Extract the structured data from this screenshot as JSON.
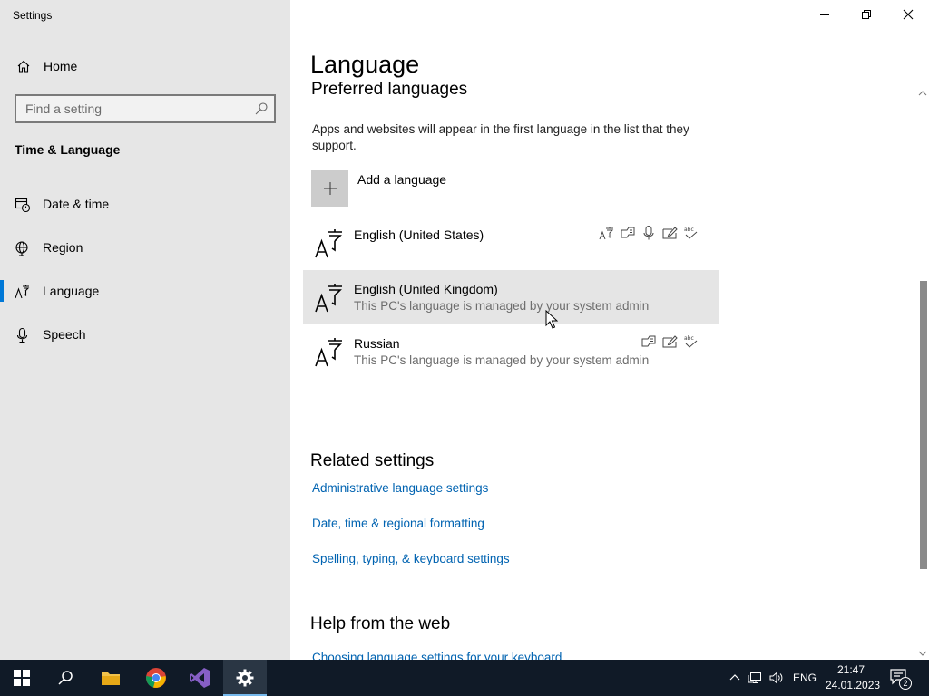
{
  "window": {
    "app_title": "Settings",
    "minimize_icon": "minimize-icon",
    "restore_icon": "restore-icon",
    "close_icon": "close-icon"
  },
  "sidebar": {
    "home_label": "Home",
    "search_placeholder": "Find a setting",
    "section_title": "Time & Language",
    "items": [
      {
        "label": "Date & time",
        "icon": "calendar-clock-icon"
      },
      {
        "label": "Region",
        "icon": "globe-icon"
      },
      {
        "label": "Language",
        "icon": "language-icon",
        "selected": true
      },
      {
        "label": "Speech",
        "icon": "microphone-icon"
      }
    ]
  },
  "main": {
    "page_title": "Language",
    "preferred_title": "Preferred languages",
    "description": "Apps and websites will appear in the first language in the list that they support.",
    "add_language_label": "Add a language",
    "languages": [
      {
        "name": "English (United States)",
        "sub": "",
        "features": [
          "display-language-icon",
          "text-to-speech-icon",
          "speech-recognition-icon",
          "handwriting-icon",
          "spelling-icon"
        ]
      },
      {
        "name": "English (United Kingdom)",
        "sub": "This PC's language is managed by your system admin",
        "features": []
      },
      {
        "name": "Russian",
        "sub": "This PC's language is managed by your system admin",
        "features": [
          "text-to-speech-icon",
          "handwriting-icon",
          "spelling-icon"
        ]
      }
    ],
    "related_title": "Related settings",
    "related_links": [
      "Administrative language settings",
      "Date, time & regional formatting",
      "Spelling, typing, & keyboard settings"
    ],
    "help_title": "Help from the web",
    "help_links": [
      "Choosing language settings for your keyboard"
    ]
  },
  "taskbar": {
    "apps": [
      "start-icon",
      "search-icon",
      "file-explorer-icon",
      "chrome-icon",
      "visual-studio-icon",
      "settings-icon"
    ],
    "lang": "ENG",
    "time": "21:47",
    "date": "24.01.2023",
    "notification_count": "2"
  },
  "colors": {
    "accent": "#0078d7",
    "link": "#0063b1",
    "sidebar_bg": "#e6e6e6",
    "taskbar_bg": "#101a27"
  }
}
